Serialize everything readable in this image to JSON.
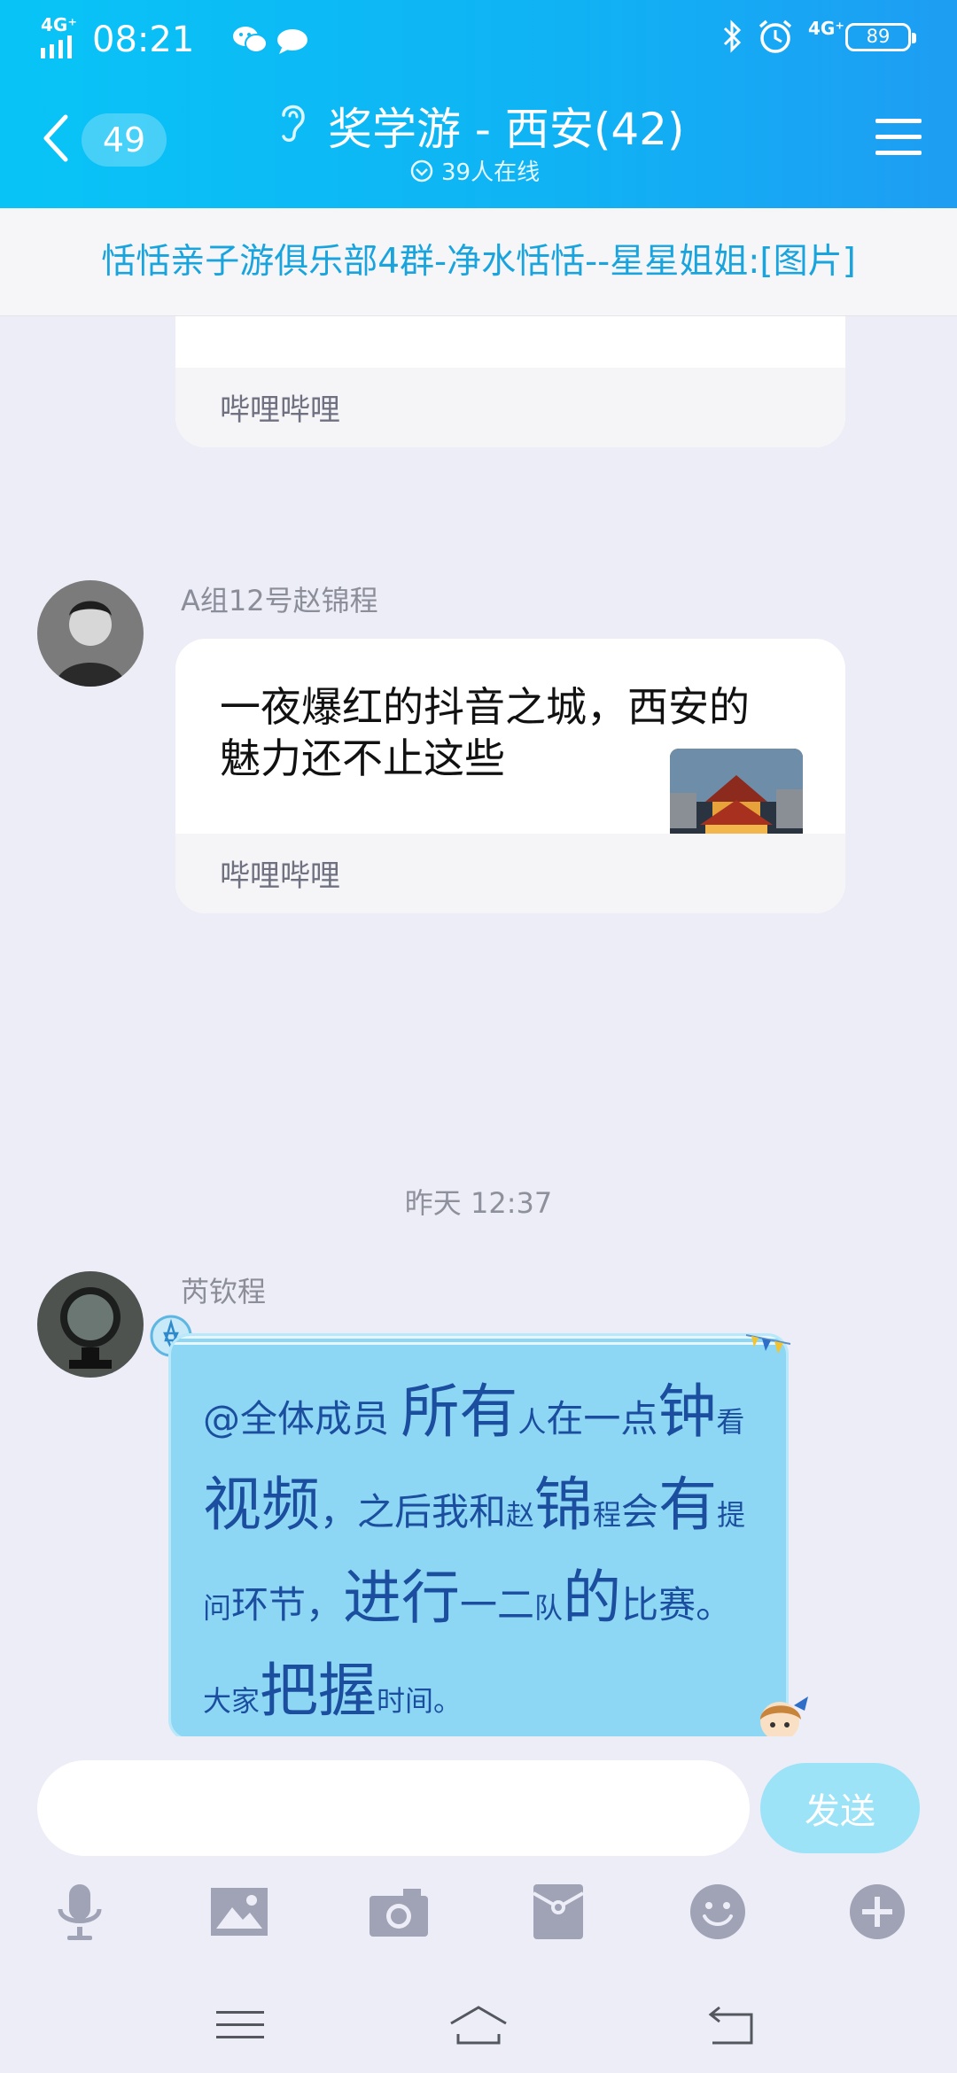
{
  "status_bar": {
    "network": "4G⁺",
    "time": "08:21",
    "network_right": "4G⁺",
    "battery": "89"
  },
  "header": {
    "back_count": "49",
    "title": "奖学游 - 西安(42)",
    "online": "39人在线"
  },
  "notice": {
    "text": "恬恬亲子游俱乐部4群-净水恬恬--星星姐姐:[图片]"
  },
  "messages": [
    {
      "type": "share-card",
      "source": "哔哩哔哩"
    },
    {
      "type": "share-card",
      "sender": "A组12号赵锦程",
      "text": "一夜爆红的抖音之城，西安的魅力还不止这些",
      "source": "哔哩哔哩"
    },
    {
      "type": "timestamp",
      "text": "昨天 12:37"
    },
    {
      "type": "text-bubble",
      "sender": "芮钦程",
      "segments": [
        {
          "t": "@全体成员 ",
          "s": "m"
        },
        {
          "t": "所有",
          "s": "l"
        },
        {
          "t": "人",
          "s": "s"
        },
        {
          "t": "在一点",
          "s": "m"
        },
        {
          "t": "钟",
          "s": "l"
        },
        {
          "t": "看",
          "s": "s"
        },
        {
          "t": "视频",
          "s": "l"
        },
        {
          "t": "，之后我和",
          "s": "m"
        },
        {
          "t": "赵",
          "s": "s"
        },
        {
          "t": "锦",
          "s": "l"
        },
        {
          "t": "程",
          "s": "s"
        },
        {
          "t": "会",
          "s": "m"
        },
        {
          "t": "有",
          "s": "l"
        },
        {
          "t": "提问",
          "s": "s"
        },
        {
          "t": "环节，",
          "s": "m"
        },
        {
          "t": "进行",
          "s": "l"
        },
        {
          "t": "一二",
          "s": "m"
        },
        {
          "t": "队",
          "s": "s"
        },
        {
          "t": "的",
          "s": "l"
        },
        {
          "t": "比赛。",
          "s": "m"
        },
        {
          "t": "大家",
          "s": "s"
        },
        {
          "t": "把握",
          "s": "l"
        },
        {
          "t": "时",
          "s": "s"
        },
        {
          "t": "间。",
          "s": "s"
        }
      ]
    }
  ],
  "input": {
    "placeholder": "",
    "send_label": "发送"
  },
  "toolbar": [
    "microphone-icon",
    "image-icon",
    "camera-icon",
    "red-packet-icon",
    "emoji-icon",
    "plus-icon"
  ],
  "navbar": [
    "menu-nav-icon",
    "home-nav-icon",
    "back-nav-icon"
  ]
}
